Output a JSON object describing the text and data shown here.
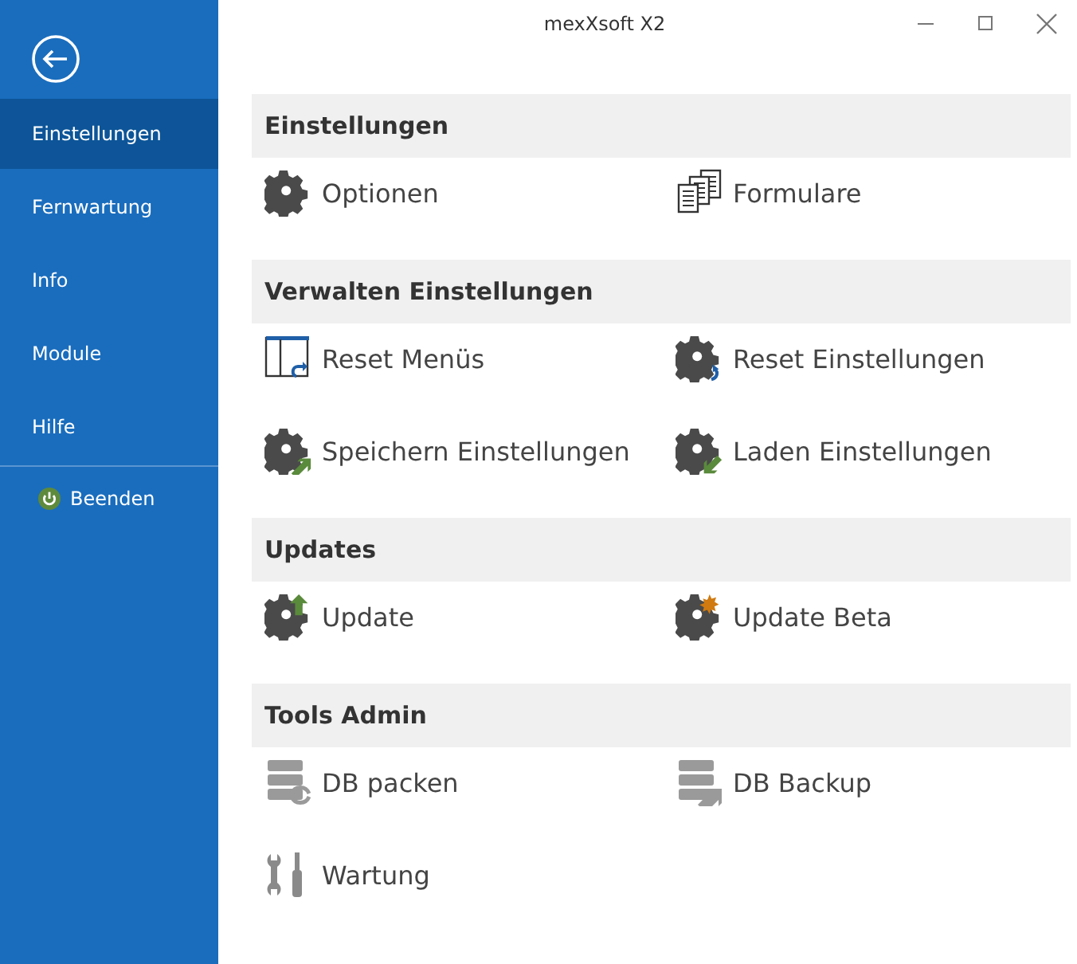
{
  "window": {
    "title": "mexXsoft X2"
  },
  "sidebar": {
    "items": [
      {
        "label": "Einstellungen",
        "selected": true
      },
      {
        "label": "Fernwartung",
        "selected": false
      },
      {
        "label": "Info",
        "selected": false
      },
      {
        "label": "Module",
        "selected": false
      },
      {
        "label": "Hilfe",
        "selected": false
      }
    ],
    "exit": {
      "label": "Beenden"
    }
  },
  "sections": [
    {
      "title": "Einstellungen",
      "items": [
        "Optionen",
        "Formulare"
      ]
    },
    {
      "title": "Verwalten Einstellungen",
      "items": [
        "Reset Menüs",
        "Reset Einstellungen",
        "Speichern Einstellungen",
        "Laden Einstellungen"
      ]
    },
    {
      "title": "Updates",
      "items": [
        "Update",
        "Update Beta"
      ]
    },
    {
      "title": "Tools Admin",
      "items": [
        "DB packen",
        "DB Backup",
        "Wartung"
      ]
    }
  ]
}
